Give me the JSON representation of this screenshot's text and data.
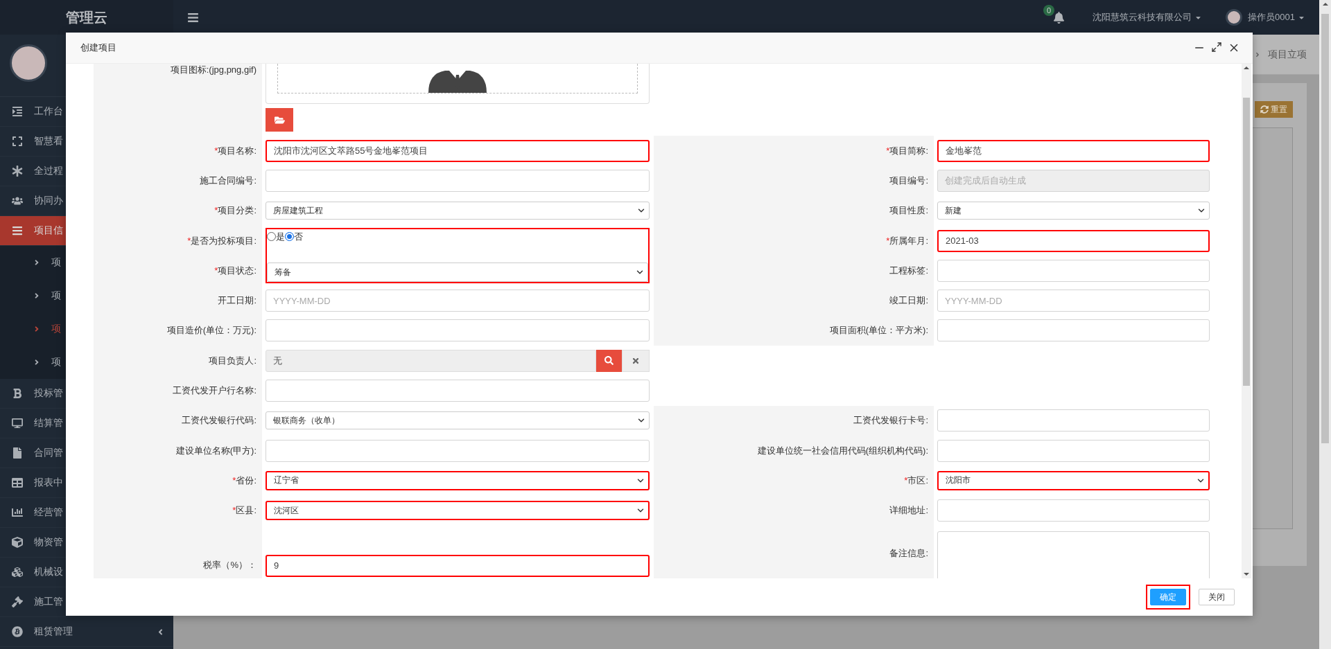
{
  "sidebar": {
    "logo": "管理云",
    "items": [
      {
        "label": "工作台",
        "selected": false
      },
      {
        "label": "智慧看",
        "selected": false
      },
      {
        "label": "全过程",
        "selected": false
      },
      {
        "label": "协同办",
        "selected": false
      },
      {
        "label": "项目信",
        "selected": true,
        "children": [
          {
            "label": "项",
            "selected": false
          },
          {
            "label": "项",
            "selected": false
          },
          {
            "label": "项",
            "selected": true
          },
          {
            "label": "项",
            "selected": false
          }
        ]
      },
      {
        "label": "投标管",
        "selected": false
      },
      {
        "label": "结算管",
        "selected": false
      },
      {
        "label": "合同管",
        "selected": false
      },
      {
        "label": "报表中",
        "selected": false
      },
      {
        "label": "经营管",
        "selected": false
      },
      {
        "label": "物资管",
        "selected": false
      },
      {
        "label": "机械设",
        "selected": false
      },
      {
        "label": "施工管",
        "selected": false
      },
      {
        "label": "租赁管理",
        "selected": false,
        "expandable": true
      }
    ]
  },
  "header": {
    "notifications": "0",
    "company": "沈阳慧筑云科技有限公司",
    "user": "操作员0001"
  },
  "background": {
    "breadcrumb": [
      "项目立项"
    ],
    "reset_button": "重置"
  },
  "modal": {
    "title": "创建项目",
    "icon_field": {
      "label": "项目图标:(jpg,png,gif)"
    },
    "rows": [
      {
        "left": {
          "kind": "text",
          "label": "项目名称:",
          "required_mark": "*",
          "value": "沈阳市沈河区文萃路55号金地峯范项目",
          "highlighted": true
        },
        "right": {
          "kind": "text",
          "label": "项目简称:",
          "required_mark": "*",
          "value": "金地峯范",
          "highlighted": true
        }
      },
      {
        "left": {
          "kind": "text",
          "label": "施工合同编号:",
          "highlighted": false
        },
        "right": {
          "kind": "readonly",
          "label": "项目编号:",
          "placeholder": "创建完成后自动生成",
          "highlighted": false
        }
      },
      {
        "left": {
          "kind": "select",
          "label": "项目分类:",
          "required_mark": "*",
          "value": "房屋建筑工程",
          "highlighted": false
        },
        "right": {
          "kind": "select",
          "label": "项目性质:",
          "value": "新建",
          "highlighted": false
        }
      },
      {
        "left": {
          "kind": "group",
          "highlighted": true,
          "fields": [
            {
              "kind": "radio",
              "label": "是否为投标项目:",
              "required_mark": "*",
              "options": [
                {
                  "label": "是",
                  "selected": false
                },
                {
                  "label": "否",
                  "selected": true
                }
              ]
            },
            {
              "kind": "select",
              "label": "项目状态:",
              "required_mark": "*",
              "value": "筹备"
            }
          ]
        },
        "right": {
          "kind": "text",
          "label": "所属年月:",
          "required_mark": "*",
          "value": "2021-03",
          "highlighted": true
        }
      },
      {
        "right": {
          "kind": "text",
          "label": "工程标签:",
          "highlighted": false
        }
      },
      {
        "left": {
          "kind": "text",
          "label": "开工日期:",
          "placeholder": "YYYY-MM-DD",
          "highlighted": false
        },
        "right": {
          "kind": "text",
          "label": "竣工日期:",
          "placeholder": "YYYY-MM-DD",
          "highlighted": false
        }
      },
      {
        "left": {
          "kind": "text",
          "label": "项目造价(单位：万元):",
          "highlighted": false
        },
        "right": {
          "kind": "text",
          "label": "项目面积(单位：平方米):",
          "highlighted": false
        }
      },
      {
        "left": {
          "kind": "lookup",
          "label": "项目负责人:",
          "value": "无"
        }
      },
      {
        "left": {
          "kind": "text",
          "label": "工资代发开户行名称:",
          "highlighted": false
        }
      },
      {
        "left": {
          "kind": "select",
          "label": "工资代发银行代码:",
          "value": "银联商务（收单）",
          "highlighted": false
        },
        "right": {
          "kind": "text",
          "label": "工资代发银行卡号:",
          "highlighted": false
        }
      },
      {
        "left": {
          "kind": "text",
          "label": "建设单位名称(甲方):",
          "highlighted": false
        },
        "right": {
          "kind": "text",
          "label": "建设单位统一社会信用代码(组织机构代码):",
          "highlighted": false
        }
      },
      {
        "left": {
          "kind": "select",
          "label": "省份:",
          "required_mark": "*",
          "value": "辽宁省",
          "highlighted": true
        },
        "right": {
          "kind": "select",
          "label": "市区:",
          "required_mark": "*",
          "value": "沈阳市",
          "highlighted": true
        }
      },
      {
        "left": {
          "kind": "select",
          "label": "区县:",
          "required_mark": "*",
          "value": "沈河区",
          "highlighted": true
        },
        "right": {
          "kind": "text",
          "label": "详细地址:",
          "highlighted": false
        }
      },
      {
        "left": {
          "kind": "text",
          "label": "税率（%）：",
          "value": "9",
          "highlighted": true
        },
        "right": {
          "kind": "textarea",
          "label": "备注信息:"
        }
      }
    ],
    "buttons": [
      {
        "label": "确定",
        "kind": "primary",
        "highlighted": true
      },
      {
        "label": "关闭",
        "kind": "default",
        "highlighted": false
      }
    ]
  }
}
